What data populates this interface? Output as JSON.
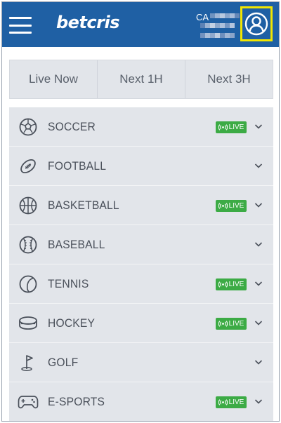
{
  "header": {
    "brand": "betcris",
    "account_code": "CA",
    "icons": {
      "menu": "hamburger-icon",
      "profile": "user-circle-icon"
    },
    "colors": {
      "bar": "#1f60a4",
      "profile_highlight": "#f2e600"
    }
  },
  "tabs": [
    {
      "label": "Live Now"
    },
    {
      "label": "Next 1H"
    },
    {
      "label": "Next 3H"
    }
  ],
  "sports": [
    {
      "name": "SOCCER",
      "live": true,
      "live_label": "LIVE",
      "icon": "soccer-ball-icon"
    },
    {
      "name": "FOOTBALL",
      "live": false,
      "icon": "football-icon"
    },
    {
      "name": "BASKETBALL",
      "live": true,
      "live_label": "LIVE",
      "icon": "basketball-icon"
    },
    {
      "name": "BASEBALL",
      "live": false,
      "icon": "baseball-icon"
    },
    {
      "name": "TENNIS",
      "live": true,
      "live_label": "LIVE",
      "icon": "tennis-ball-icon"
    },
    {
      "name": "HOCKEY",
      "live": true,
      "live_label": "LIVE",
      "icon": "hockey-puck-icon"
    },
    {
      "name": "GOLF",
      "live": false,
      "icon": "golf-flag-icon"
    },
    {
      "name": "E-SPORTS",
      "live": true,
      "live_label": "LIVE",
      "icon": "gamepad-icon"
    }
  ],
  "colors": {
    "live_badge": "#3cab45",
    "list_bg": "#e2e5ea",
    "text": "#4a505a"
  }
}
